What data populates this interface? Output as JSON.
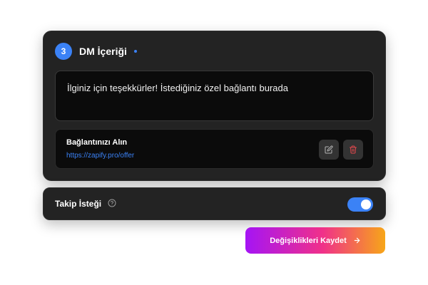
{
  "dm_section": {
    "step_number": "3",
    "title": "DM İçeriği",
    "message": "İlginiz için teşekkürler! İstediğiniz özel bağlantı burada",
    "link": {
      "title": "Bağlantınızı Alın",
      "url": "https://zapify.pro/offer"
    }
  },
  "follow_request": {
    "label": "Takip İsteği",
    "enabled": true
  },
  "actions": {
    "save_label": "Değişiklikleri Kaydet"
  },
  "icons": {
    "edit": "edit-icon",
    "delete": "trash-icon",
    "help": "help-circle-icon",
    "arrow": "arrow-right-icon"
  },
  "colors": {
    "accent": "#3b82f6",
    "card_bg": "#232323",
    "delete_icon": "#e5484d",
    "gradient": [
      "#a514f5",
      "#f0308a",
      "#f7a618"
    ]
  }
}
